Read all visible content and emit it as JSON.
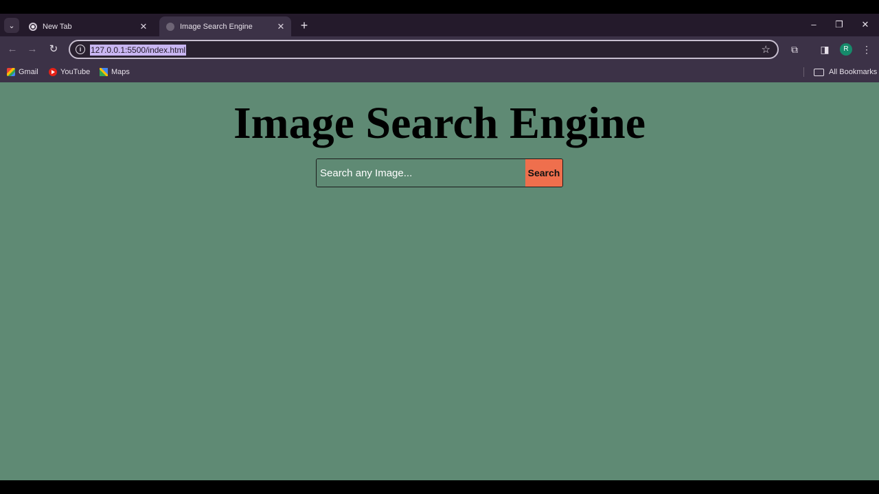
{
  "browser": {
    "tabs": [
      {
        "title": "New Tab",
        "active": false
      },
      {
        "title": "Image Search Engine",
        "active": true
      }
    ],
    "tab_close_glyph": "✕",
    "new_tab_glyph": "+",
    "window_controls": {
      "minimize": "–",
      "restore": "❐",
      "close": "✕"
    },
    "address_bar": {
      "url": "127.0.0.1:5500/index.html"
    },
    "profile_initial": "R",
    "bookmarks": [
      {
        "label": "Gmail",
        "icon": "gmail-icon"
      },
      {
        "label": "YouTube",
        "icon": "youtube-icon"
      },
      {
        "label": "Maps",
        "icon": "maps-icon"
      }
    ],
    "all_bookmarks_label": "All Bookmarks"
  },
  "page": {
    "title": "Image Search Engine",
    "search": {
      "value": "",
      "placeholder": "Search any Image...",
      "button_label": "Search"
    }
  },
  "colors": {
    "page_background": "#5f8a74",
    "search_button": "#ef6f4d",
    "browser_chrome": "#3c3247",
    "tab_strip": "#241a2b"
  }
}
